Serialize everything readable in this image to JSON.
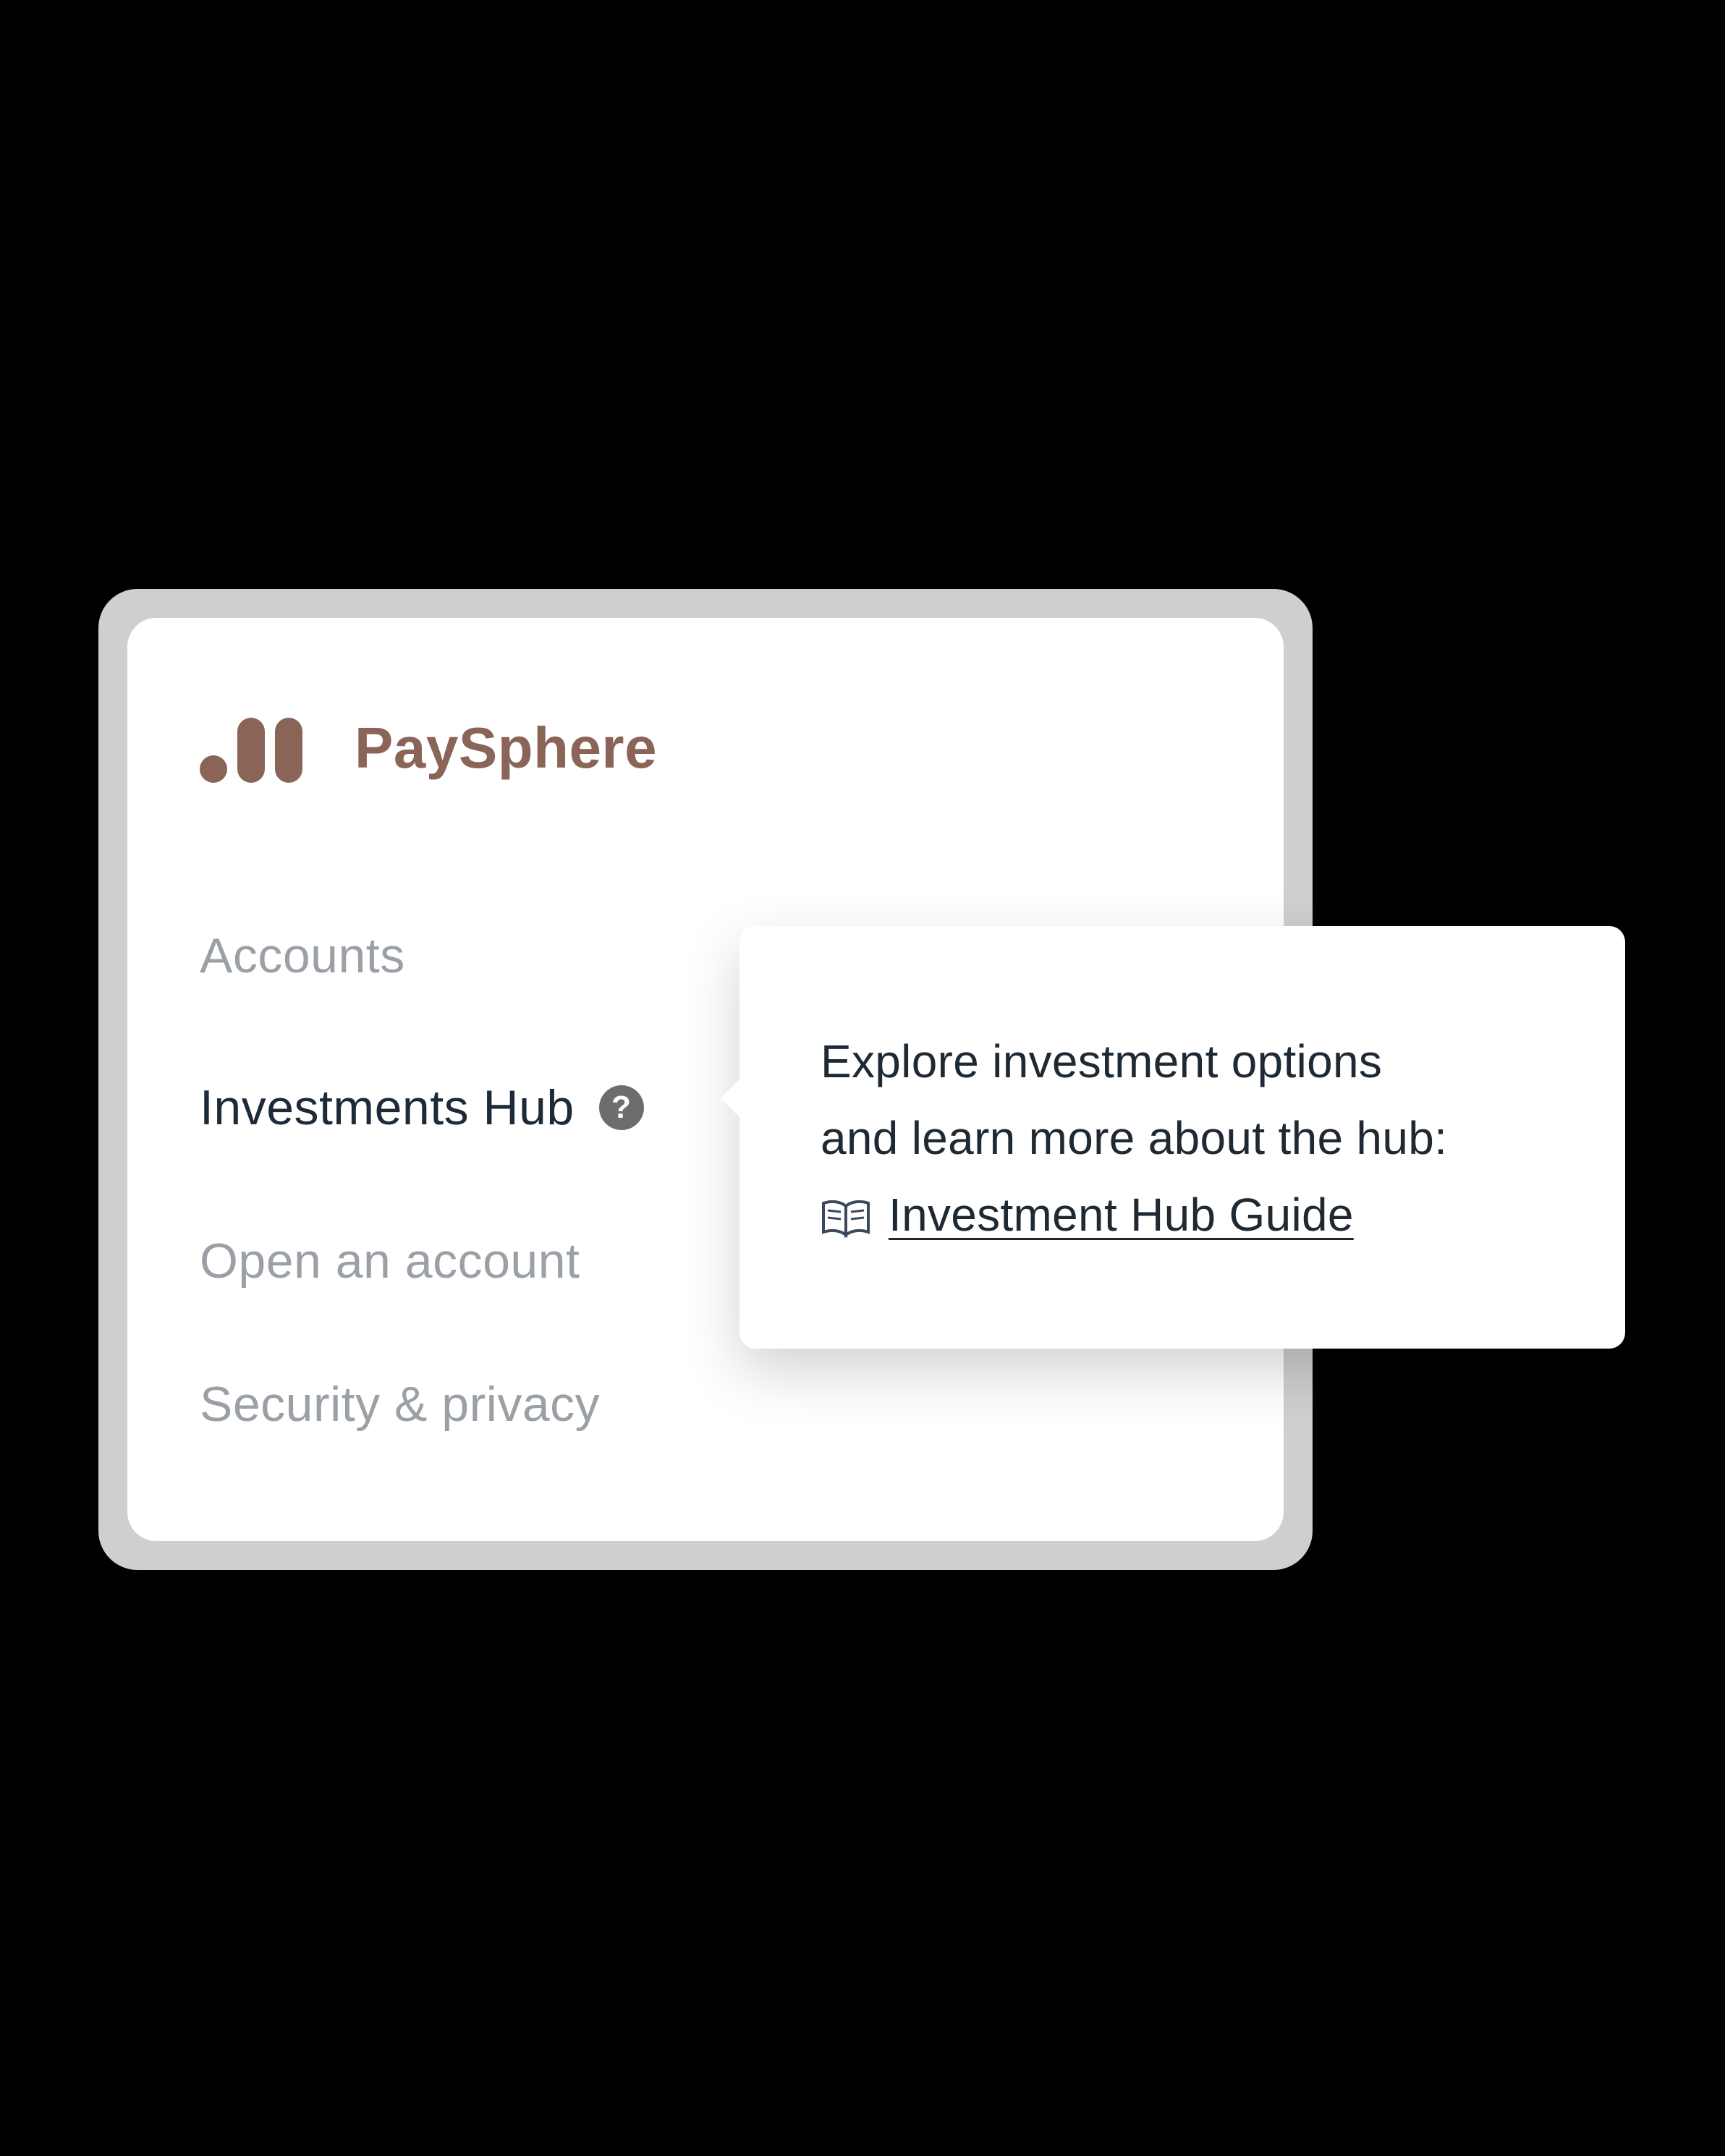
{
  "brand": {
    "name": "PaySphere",
    "color": "#8a6557"
  },
  "nav": {
    "items": [
      {
        "label": "Accounts"
      },
      {
        "label": "Investments Hub"
      },
      {
        "label": "Open an account"
      },
      {
        "label": "Security & privacy"
      }
    ],
    "active_index": 1,
    "help_icon": "question-mark-icon",
    "help_glyph": "?"
  },
  "tooltip": {
    "line1": "Explore investment options",
    "line2": "and learn more about the hub:",
    "link_icon": "open-book-icon",
    "link_label": "Investment Hub Guide"
  },
  "colors": {
    "background": "#000000",
    "frame": "#cfcfcf",
    "inactive_text": "#9aa0a6",
    "active_text": "#1d2a3a"
  }
}
